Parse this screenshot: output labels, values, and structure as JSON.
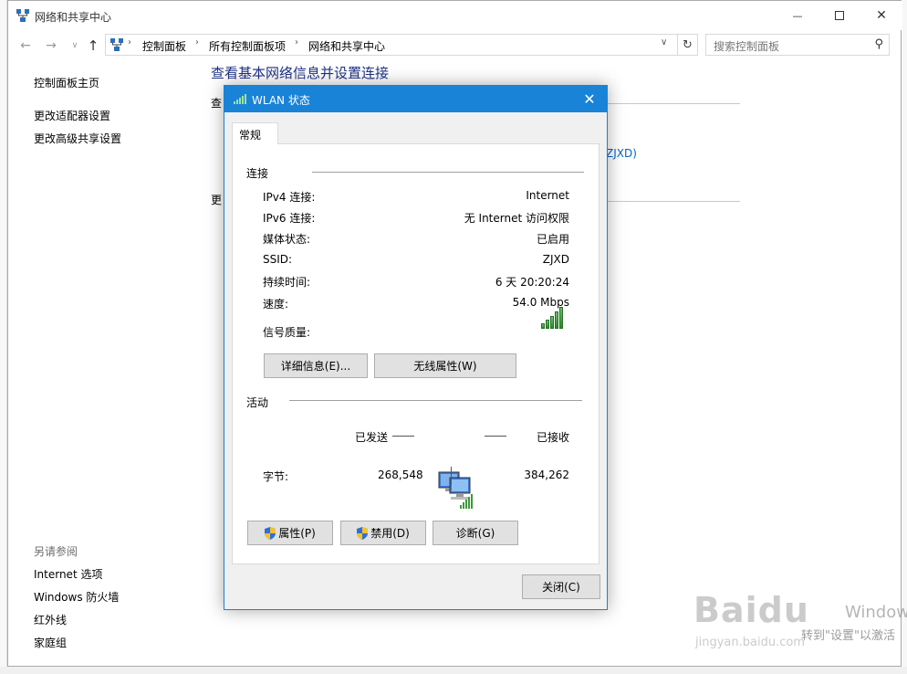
{
  "window": {
    "title": "网络和共享中心",
    "controls": {
      "minimize": "—",
      "maximize": "",
      "close": "✕"
    }
  },
  "address": {
    "breadcrumbs": [
      "控制面板",
      "所有控制面板项",
      "网络和共享中心"
    ],
    "search_placeholder": "搜索控制面板"
  },
  "leftnav": {
    "links": [
      "控制面板主页",
      "更改适配器设置",
      "更改高级共享设置"
    ],
    "see_also_label": "另请参阅",
    "see_also": [
      "Internet 选项",
      "Windows 防火墙",
      "红外线",
      "家庭组"
    ]
  },
  "content": {
    "title": "查看基本网络信息并设置连接",
    "frag1": "查",
    "frag2": "更",
    "link_frag": "ZJXD)"
  },
  "dialog": {
    "title": "WLAN 状态",
    "close_glyph": "✕",
    "tab": "常规",
    "connection": {
      "label": "连接",
      "rows": [
        {
          "label": "IPv4 连接:",
          "value": "Internet"
        },
        {
          "label": "IPv6 连接:",
          "value": "无 Internet 访问权限"
        },
        {
          "label": "媒体状态:",
          "value": "已启用"
        },
        {
          "label": "SSID:",
          "value": "ZJXD"
        },
        {
          "label": "持续时间:",
          "value": "6 天 20:20:24"
        },
        {
          "label": "速度:",
          "value": "54.0 Mbps"
        }
      ],
      "signal_label": "信号质量:",
      "signal_bars_active": 5,
      "signal_bars_total": 5
    },
    "buttons": {
      "details": "详细信息(E)...",
      "wireless": "无线属性(W)"
    },
    "activity": {
      "label": "活动",
      "sent_label": "已发送",
      "received_label": "已接收",
      "bytes_label": "字节:",
      "sent": "268,548",
      "received": "384,262"
    },
    "bottom_buttons": {
      "properties": "属性(P)",
      "disable": "禁用(D)",
      "diagnose": "诊断(G)"
    },
    "close_button": "关闭(C)"
  },
  "watermark": {
    "line1": "Baidu",
    "line2": "jingyan.baidu.com",
    "activate1": "Windows",
    "activate2": "转到\"设置\"以激活"
  },
  "colors": {
    "accent": "#1883d7",
    "title_blue": "#1e3287",
    "link": "#0066cc"
  }
}
